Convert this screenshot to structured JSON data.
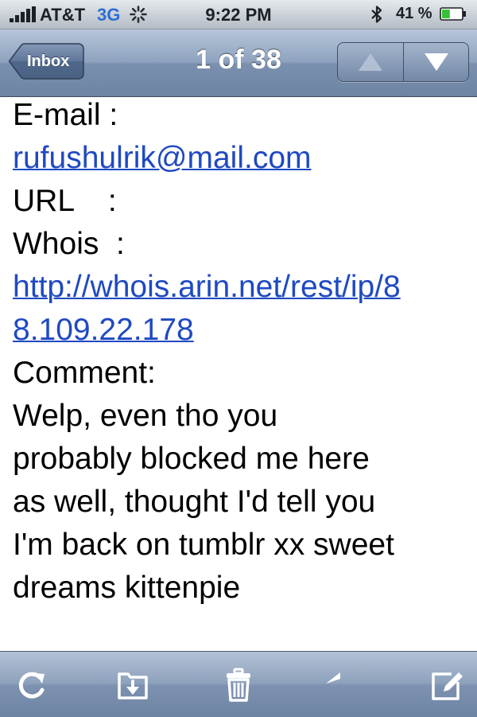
{
  "status_bar": {
    "carrier": "AT&T",
    "network": "3G",
    "time": "9:22 PM",
    "battery_percent": "41 %",
    "icons": [
      "signal-bars-icon",
      "activity-spinner-icon",
      "bluetooth-icon",
      "battery-icon"
    ],
    "battery_level": 0.41
  },
  "nav": {
    "back_label": "Inbox",
    "title": "1 of 38",
    "up_icon": "arrow-up-icon",
    "down_icon": "arrow-down-icon"
  },
  "message": {
    "email_label": "E-mail :",
    "email_value": "rufushulrik@mail.com",
    "url_label": "URL    :",
    "whois_label": "Whois  :",
    "whois_link_line1": "http://whois.arin.net/rest/ip/8",
    "whois_link_line2": "8.109.22.178",
    "comment_label": "Comment:",
    "comment_lines": [
      "Welp, even tho you",
      "probably blocked me here",
      "as well, thought I'd tell you",
      "I'm back on tumblr xx sweet",
      "dreams kittenpie"
    ]
  },
  "toolbar": {
    "icons": [
      "refresh-icon",
      "move-to-folder-icon",
      "trash-icon",
      "reply-icon",
      "compose-icon"
    ]
  },
  "colors": {
    "link": "#1f49c2",
    "nav_bar": "#7a90ae",
    "network_indicator": "#2b6fd3",
    "battery_fill": "#38c138"
  }
}
